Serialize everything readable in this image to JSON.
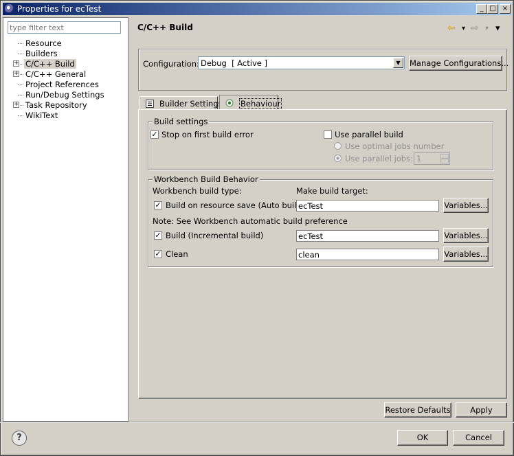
{
  "window": {
    "title": "Properties for ecTest",
    "minimize": "_",
    "maximize": "□",
    "close": "×"
  },
  "left": {
    "filter_placeholder": "type filter text",
    "tree": [
      {
        "label": "Resource",
        "expandable": false,
        "selected": false
      },
      {
        "label": "Builders",
        "expandable": false,
        "selected": false
      },
      {
        "label": "C/C++ Build",
        "expandable": true,
        "selected": true
      },
      {
        "label": "C/C++ General",
        "expandable": true,
        "selected": false
      },
      {
        "label": "Project References",
        "expandable": false,
        "selected": false
      },
      {
        "label": "Run/Debug Settings",
        "expandable": false,
        "selected": false
      },
      {
        "label": "Task Repository",
        "expandable": true,
        "selected": false
      },
      {
        "label": "WikiText",
        "expandable": false,
        "selected": false
      }
    ],
    "expander_glyph": "+"
  },
  "page": {
    "title": "C/C++ Build",
    "nav": {
      "back": "⇦",
      "dropdown": "▾",
      "forward": "⇨",
      "menu": "▾"
    },
    "configuration_label": "Configuration:",
    "configuration_value": "Debug  [ Active ]",
    "manage_button": "Manage Configurations...",
    "tabs": [
      {
        "label": "Builder Settings",
        "icon": "list-icon",
        "active": false
      },
      {
        "label": "Behaviour",
        "icon": "radio-icon",
        "active": true
      }
    ]
  },
  "build_settings": {
    "group_title": "Build settings",
    "stop_on_error": {
      "label": "Stop on first build error",
      "checked": true
    },
    "parallel": {
      "label": "Use parallel build",
      "checked": false
    },
    "optimal_jobs": {
      "label": "Use optimal jobs number",
      "enabled": false
    },
    "parallel_jobs": {
      "label": "Use parallel jobs:",
      "value": "1",
      "enabled": false
    }
  },
  "workbench": {
    "group_title": "Workbench Build Behavior",
    "type_label": "Workbench build type:",
    "target_label": "Make build target:",
    "note": "Note: See Workbench automatic build preference",
    "rows": [
      {
        "label": "Build on resource save (Auto build)",
        "checked": true,
        "target": "ecTest",
        "button": "Variables..."
      },
      {
        "label": "Build (Incremental build)",
        "checked": true,
        "target": "ecTest",
        "button": "Variables..."
      },
      {
        "label": "Clean",
        "checked": true,
        "target": "clean",
        "button": "Variables..."
      }
    ]
  },
  "footer": {
    "restore_defaults": "Restore Defaults",
    "apply": "Apply",
    "ok": "OK",
    "cancel": "Cancel",
    "help": "?"
  },
  "colors": {
    "title_start": "#0a246a",
    "title_end": "#a6caf0",
    "face": "#d4d0c8"
  },
  "check_glyph": "✓"
}
